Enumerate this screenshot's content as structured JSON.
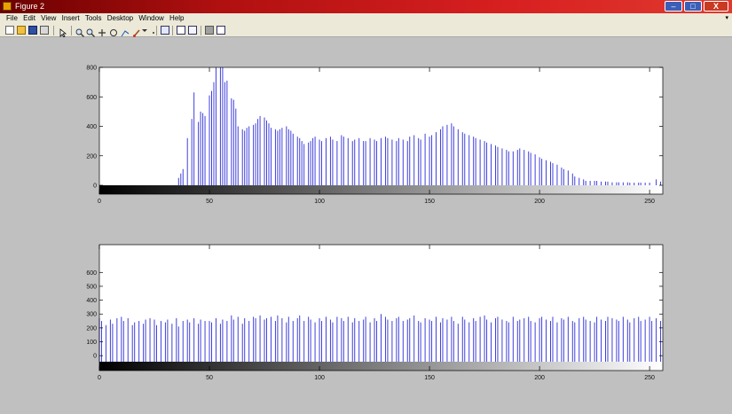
{
  "window": {
    "title": "Figure 2",
    "min_glyph": "–",
    "max_glyph": "□",
    "close_glyph": "X"
  },
  "menu": {
    "items": [
      "File",
      "Edit",
      "View",
      "Insert",
      "Tools",
      "Desktop",
      "Window",
      "Help"
    ],
    "arrow": "▾"
  },
  "toolbar": {
    "icons": [
      "new-figure-icon",
      "open-file-icon",
      "save-icon",
      "print-icon",
      "edit-plot-icon",
      "zoom-in-icon",
      "zoom-out-icon",
      "pan-icon",
      "rotate-3d-icon",
      "data-cursor-icon",
      "brush-icon",
      "link-plot-icon",
      "insert-colorbar-icon",
      "insert-legend-icon",
      "hide-plot-tools-icon",
      "show-plot-tools-icon"
    ]
  },
  "chart_data": [
    {
      "type": "bar",
      "xlim": [
        0,
        256
      ],
      "ylim": [
        0,
        800
      ],
      "xticks": [
        0,
        50,
        100,
        150,
        200,
        250
      ],
      "xtick_labels": [
        "0",
        "50",
        "100",
        "150",
        "200",
        "250"
      ],
      "yticks": [
        0,
        200,
        400,
        600,
        800
      ],
      "ytick_labels": [
        "0",
        "200",
        "400",
        "600",
        "800"
      ],
      "grid": false,
      "bar_color": "#4040dd",
      "colorbar": "grayscale",
      "x": [
        36,
        37,
        38,
        40,
        42,
        43,
        45,
        46,
        47,
        48,
        50,
        51,
        52,
        53,
        55,
        56,
        57,
        58,
        60,
        61,
        62,
        63,
        65,
        66,
        67,
        68,
        70,
        71,
        72,
        73,
        75,
        76,
        77,
        78,
        80,
        81,
        82,
        83,
        85,
        86,
        87,
        88,
        90,
        91,
        92,
        93,
        95,
        96,
        97,
        98,
        100,
        101,
        103,
        105,
        106,
        108,
        110,
        111,
        113,
        115,
        116,
        118,
        120,
        121,
        123,
        125,
        126,
        128,
        130,
        131,
        133,
        135,
        136,
        138,
        140,
        141,
        143,
        145,
        146,
        148,
        150,
        151,
        153,
        155,
        156,
        158,
        160,
        161,
        163,
        165,
        166,
        168,
        170,
        171,
        173,
        175,
        176,
        178,
        180,
        181,
        183,
        185,
        186,
        188,
        190,
        191,
        193,
        195,
        196,
        198,
        200,
        201,
        203,
        205,
        206,
        208,
        210,
        211,
        213,
        215,
        216,
        218,
        220,
        221,
        223,
        225,
        226,
        228,
        230,
        231,
        233,
        235,
        236,
        238,
        240,
        241,
        243,
        245,
        246,
        248,
        250,
        253,
        255
      ],
      "values": [
        50,
        80,
        110,
        320,
        450,
        630,
        430,
        500,
        490,
        470,
        610,
        640,
        700,
        800,
        810,
        800,
        700,
        710,
        590,
        580,
        520,
        400,
        380,
        370,
        390,
        400,
        410,
        420,
        450,
        470,
        460,
        440,
        420,
        390,
        380,
        370,
        380,
        390,
        400,
        380,
        370,
        350,
        330,
        320,
        300,
        280,
        290,
        300,
        320,
        330,
        310,
        300,
        320,
        330,
        310,
        300,
        340,
        330,
        320,
        300,
        310,
        320,
        300,
        300,
        320,
        310,
        300,
        320,
        330,
        320,
        310,
        300,
        320,
        310,
        300,
        330,
        340,
        320,
        310,
        350,
        330,
        340,
        360,
        380,
        400,
        410,
        420,
        400,
        380,
        360,
        350,
        340,
        330,
        320,
        310,
        300,
        290,
        280,
        270,
        260,
        250,
        240,
        230,
        230,
        240,
        250,
        240,
        230,
        220,
        210,
        190,
        180,
        170,
        160,
        150,
        140,
        120,
        110,
        100,
        80,
        60,
        50,
        40,
        30,
        30,
        30,
        30,
        25,
        25,
        25,
        20,
        20,
        20,
        20,
        20,
        18,
        18,
        18,
        18,
        18,
        18,
        40,
        25
      ]
    },
    {
      "type": "bar",
      "xlim": [
        0,
        256
      ],
      "ylim": [
        -50,
        800
      ],
      "xticks": [
        0,
        50,
        100,
        150,
        200,
        250
      ],
      "xtick_labels": [
        "0",
        "50",
        "100",
        "150",
        "200",
        "250"
      ],
      "yticks": [
        0,
        100,
        200,
        300,
        400,
        500,
        600
      ],
      "ytick_labels": [
        "0",
        "100",
        "200",
        "300",
        "400",
        "500",
        "600"
      ],
      "grid": false,
      "bar_color": "#4040dd",
      "colorbar": "grayscale",
      "x": [
        0,
        1,
        3,
        5,
        6,
        8,
        10,
        11,
        13,
        15,
        16,
        18,
        20,
        21,
        23,
        25,
        26,
        28,
        30,
        31,
        33,
        35,
        36,
        38,
        40,
        41,
        43,
        45,
        46,
        48,
        50,
        51,
        53,
        55,
        56,
        58,
        60,
        61,
        63,
        65,
        66,
        68,
        70,
        71,
        73,
        75,
        76,
        78,
        80,
        81,
        83,
        85,
        86,
        88,
        90,
        91,
        93,
        95,
        96,
        98,
        100,
        101,
        103,
        105,
        106,
        108,
        110,
        111,
        113,
        115,
        116,
        118,
        120,
        121,
        123,
        125,
        126,
        128,
        130,
        131,
        133,
        135,
        136,
        138,
        140,
        141,
        143,
        145,
        146,
        148,
        150,
        151,
        153,
        155,
        156,
        158,
        160,
        161,
        163,
        165,
        166,
        168,
        170,
        171,
        173,
        175,
        176,
        178,
        180,
        181,
        183,
        185,
        186,
        188,
        190,
        191,
        193,
        195,
        196,
        198,
        200,
        201,
        203,
        205,
        206,
        208,
        210,
        211,
        213,
        215,
        216,
        218,
        220,
        221,
        223,
        225,
        226,
        228,
        230,
        231,
        233,
        235,
        236,
        238,
        240,
        241,
        243,
        245,
        246,
        248,
        250,
        251,
        253,
        255
      ],
      "values": [
        270,
        250,
        220,
        260,
        230,
        270,
        280,
        250,
        270,
        220,
        240,
        250,
        230,
        260,
        270,
        260,
        220,
        250,
        240,
        260,
        230,
        270,
        210,
        250,
        260,
        240,
        270,
        230,
        260,
        250,
        250,
        240,
        270,
        230,
        260,
        250,
        290,
        260,
        280,
        230,
        270,
        250,
        280,
        270,
        290,
        260,
        270,
        280,
        250,
        290,
        270,
        240,
        280,
        250,
        270,
        290,
        250,
        280,
        260,
        240,
        270,
        250,
        280,
        260,
        240,
        280,
        270,
        250,
        280,
        240,
        270,
        250,
        260,
        280,
        240,
        270,
        250,
        300,
        280,
        260,
        250,
        270,
        280,
        250,
        260,
        270,
        290,
        250,
        240,
        270,
        260,
        250,
        280,
        240,
        270,
        260,
        280,
        250,
        230,
        280,
        260,
        240,
        270,
        250,
        280,
        290,
        260,
        240,
        270,
        280,
        260,
        250,
        240,
        280,
        250,
        260,
        270,
        280,
        250,
        240,
        270,
        280,
        260,
        250,
        280,
        240,
        270,
        260,
        280,
        250,
        240,
        270,
        280,
        260,
        250,
        240,
        280,
        260,
        250,
        280,
        270,
        260,
        250,
        280,
        260,
        240,
        270,
        280,
        250,
        260,
        280,
        250,
        270,
        250
      ]
    }
  ]
}
